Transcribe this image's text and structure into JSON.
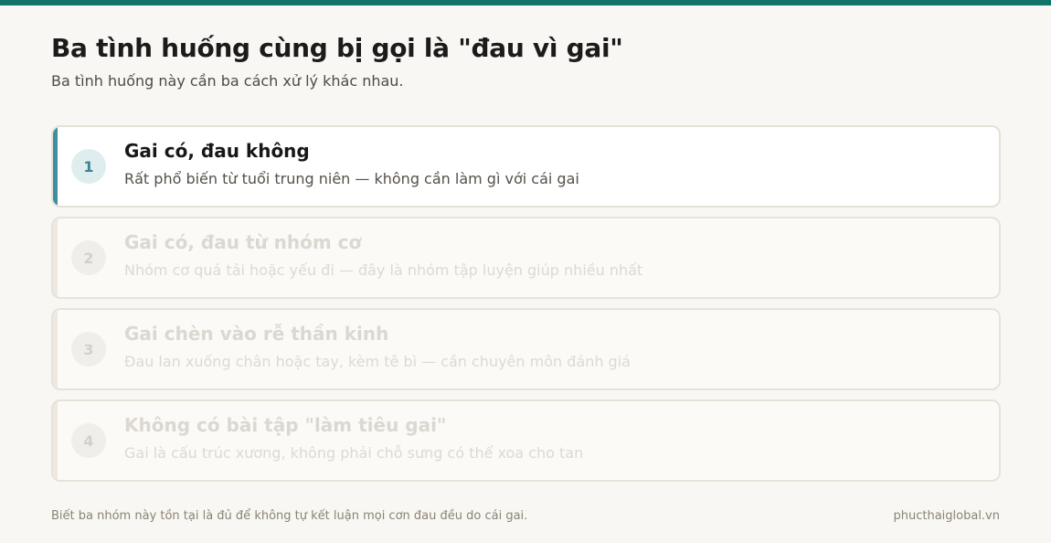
{
  "header": {
    "title": "Ba tình huống cùng bị gọi là \"đau vì gai\"",
    "subtitle": "Ba tình huống này cần ba cách xử lý khác nhau."
  },
  "cards": [
    {
      "number": "1",
      "title": "Gai có, đau không",
      "description": "Rất phổ biến từ tuổi trung niên — không cần làm gì với cái gai",
      "active": true
    },
    {
      "number": "2",
      "title": "Gai có, đau từ nhóm cơ",
      "description": "Nhóm cơ quá tải hoặc yếu đi — đây là nhóm tập luyện giúp nhiều nhất",
      "active": false
    },
    {
      "number": "3",
      "title": "Gai chèn vào rễ thần kinh",
      "description": "Đau lan xuống chân hoặc tay, kèm tê bì — cần chuyên môn đánh giá",
      "active": false
    },
    {
      "number": "4",
      "title": "Không có bài tập \"làm tiêu gai\"",
      "description": "Gai là cấu trúc xương, không phải chỗ sưng có thể xoa cho tan",
      "active": false
    }
  ],
  "footer": {
    "note": "Biết ba nhóm này tồn tại là đủ để không tự kết luận mọi cơn đau đều do cái gai.",
    "site": "phucthaiglobal.vn"
  },
  "colors": {
    "top_bar": "#127468",
    "accent_active": "#3e8fa0",
    "background": "#f9f7f3"
  }
}
